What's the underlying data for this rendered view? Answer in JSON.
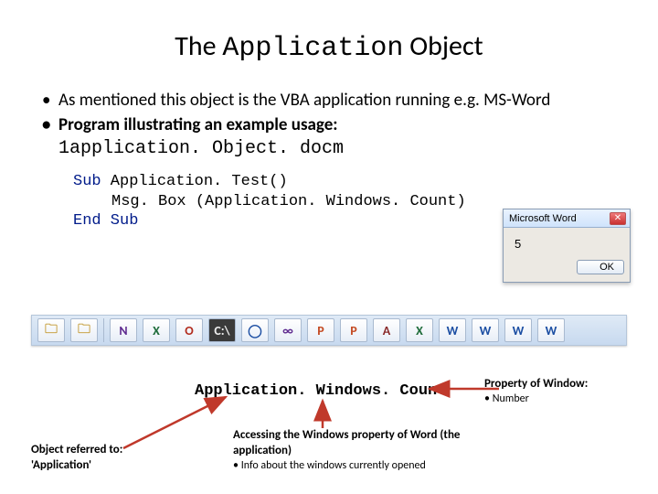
{
  "title": {
    "pre": "The ",
    "mono": "Application",
    "post": " Object"
  },
  "bullets": {
    "b1": "As mentioned this object is the VBA application running e.g. MS-Word",
    "b2": "Program illustrating an example usage:"
  },
  "filename": "1application. Object. docm",
  "code": {
    "l1a": "Sub",
    "l1b": " Application. Test()",
    "l2": "Msg. Box (Application. Windows. Count)",
    "l3a": "End",
    "l3b": " Sub"
  },
  "dialog": {
    "title": "Microsoft Word",
    "value": "5",
    "ok": "OK",
    "close_glyph": "✕"
  },
  "taskbar_icons": [
    {
      "name": "folder-icon",
      "glyph": "🗀",
      "cls": "ic-fold"
    },
    {
      "name": "folder-icon",
      "glyph": "🗀",
      "cls": "ic-fold"
    },
    {
      "name": "onenote-icon",
      "glyph": "N",
      "cls": "ic-vs"
    },
    {
      "name": "excel-icon",
      "glyph": "X",
      "cls": "ic-excel"
    },
    {
      "name": "opera-icon",
      "glyph": "O",
      "cls": "ic-opera"
    },
    {
      "name": "terminal-icon",
      "glyph": "C:\\",
      "cls": "ic-black"
    },
    {
      "name": "messenger-icon",
      "glyph": "◯",
      "cls": "ic-word"
    },
    {
      "name": "visualstudio-icon",
      "glyph": "∞",
      "cls": "ic-vs"
    },
    {
      "name": "powerpoint-icon",
      "glyph": "P",
      "cls": "ic-ppt"
    },
    {
      "name": "powerpoint-icon",
      "glyph": "P",
      "cls": "ic-ppt"
    },
    {
      "name": "access-icon",
      "glyph": "A",
      "cls": "ic-acc"
    },
    {
      "name": "excel-icon",
      "glyph": "X",
      "cls": "ic-excel"
    },
    {
      "name": "word-icon",
      "glyph": "W",
      "cls": "ic-word"
    },
    {
      "name": "word-icon",
      "glyph": "W",
      "cls": "ic-word"
    },
    {
      "name": "word-icon",
      "glyph": "W",
      "cls": "ic-word"
    },
    {
      "name": "word-icon",
      "glyph": "W",
      "cls": "ic-word"
    }
  ],
  "expression": "Application. Windows. Count",
  "annot": {
    "right_title": "Property of Window:",
    "right_sub": "Number",
    "left_l1": "Object referred to:",
    "left_l2": "'Application'",
    "mid_title": "Accessing the Windows property of Word (the application)",
    "mid_sub": "Info about the windows currently opened"
  }
}
